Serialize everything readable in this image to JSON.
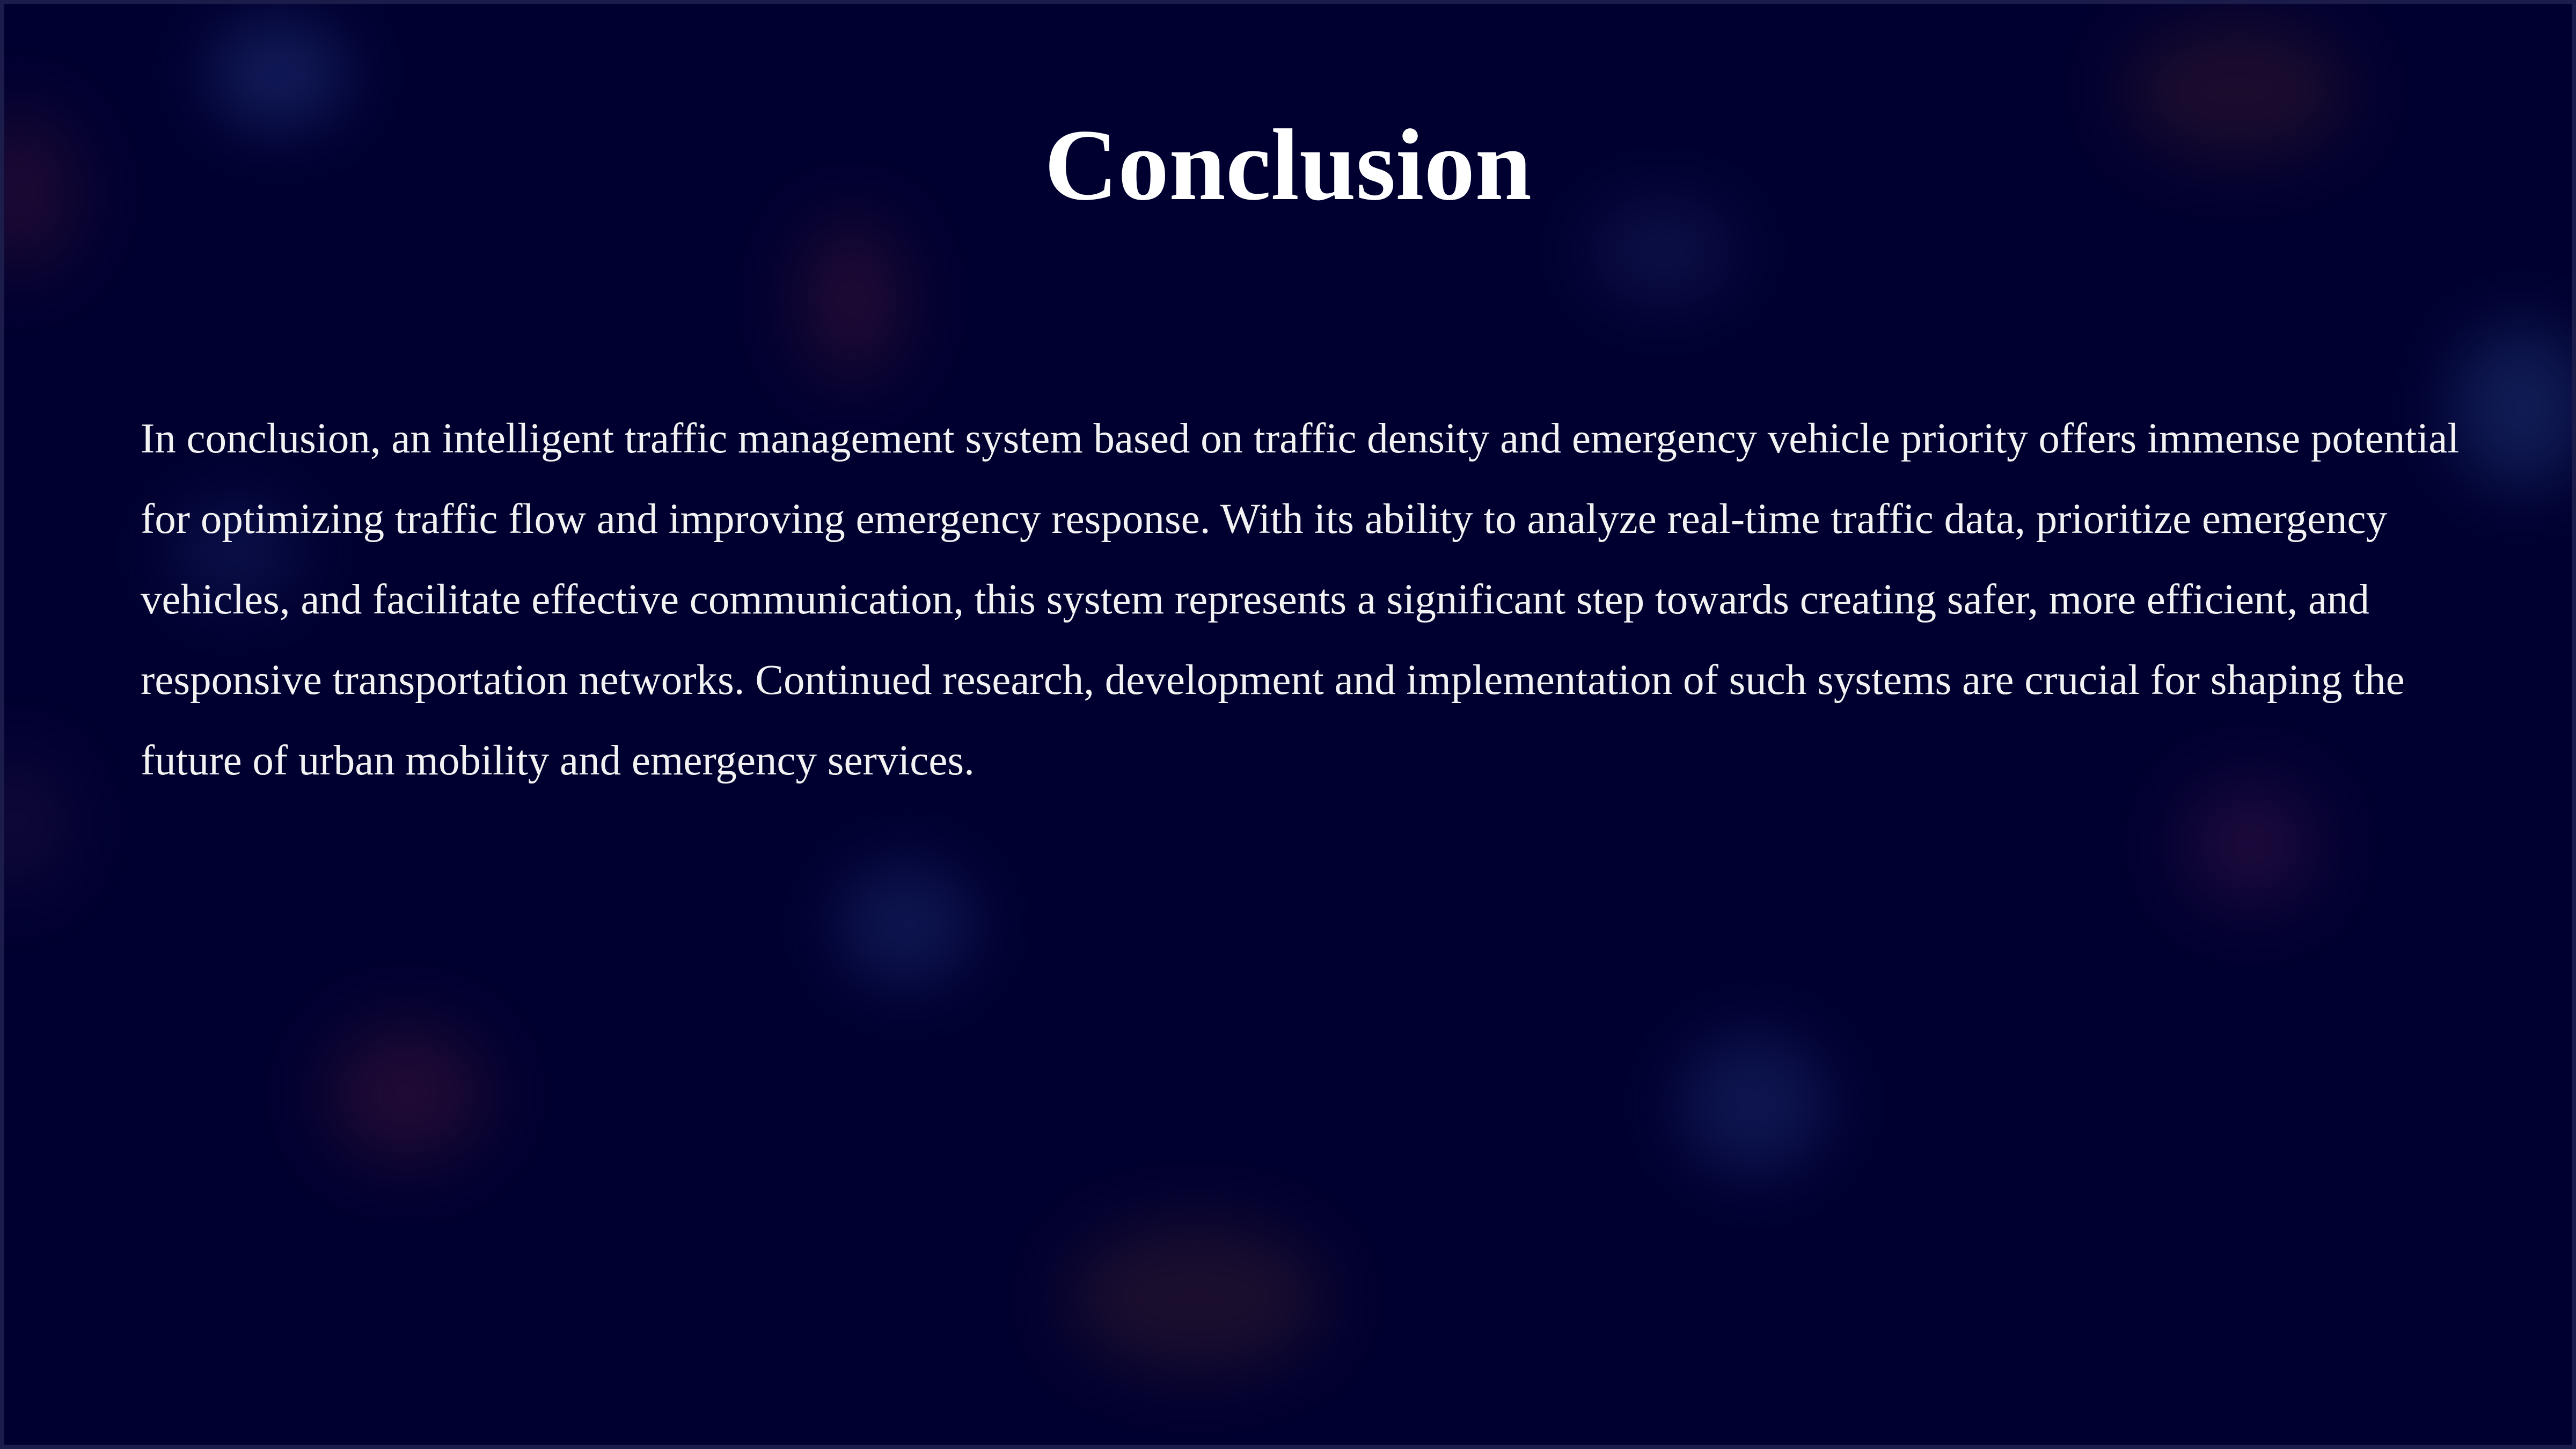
{
  "slide": {
    "title": "Conclusion",
    "body": "In conclusion, an intelligent traffic management system based on traffic density and emergency vehicle priority offers immense potential for optimizing traffic flow and improving emergency response. With its ability to analyze real-time traffic data, prioritize emergency vehicles, and facilitate effective communication, this system represents a significant step towards creating safer, more efficient, and responsive transportation networks. Continued research, development and implementation of such systems are crucial for shaping the future of urban mobility and emergency services."
  },
  "colors": {
    "background": "#000030",
    "text": "#ffffff",
    "border": "#1c1c4a"
  }
}
